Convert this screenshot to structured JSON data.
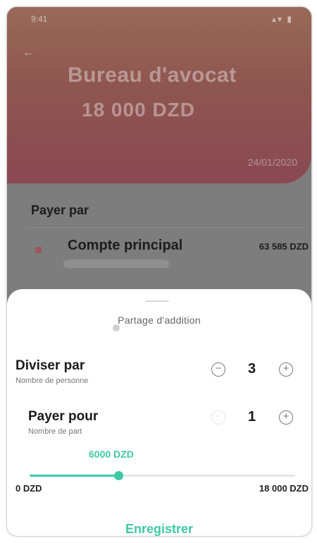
{
  "header": {
    "title": "Bureau d'avocat",
    "amount": "18 000  DZD",
    "date": "24/01/2020",
    "bg_color": "#8a4853",
    "back_icon": "arrow-left-icon"
  },
  "payment": {
    "label": "Payer par",
    "account_name": "Compte principal",
    "account_balance": "63 585 DZD"
  },
  "sheet": {
    "title": "Partage d'addition",
    "divide": {
      "title": "Diviser par",
      "subtitle": "Nombre de personne",
      "value": "3"
    },
    "pay_for": {
      "title": "Payer pour",
      "subtitle": "Nombre de part",
      "value": "1"
    },
    "slider": {
      "current_label": "6000 DZD",
      "min_label": "0 DZD",
      "max_label": "18 000 DZD",
      "fraction": 0.333
    },
    "save_label": "Enregistrer",
    "accent_color": "#3fc9a5"
  }
}
